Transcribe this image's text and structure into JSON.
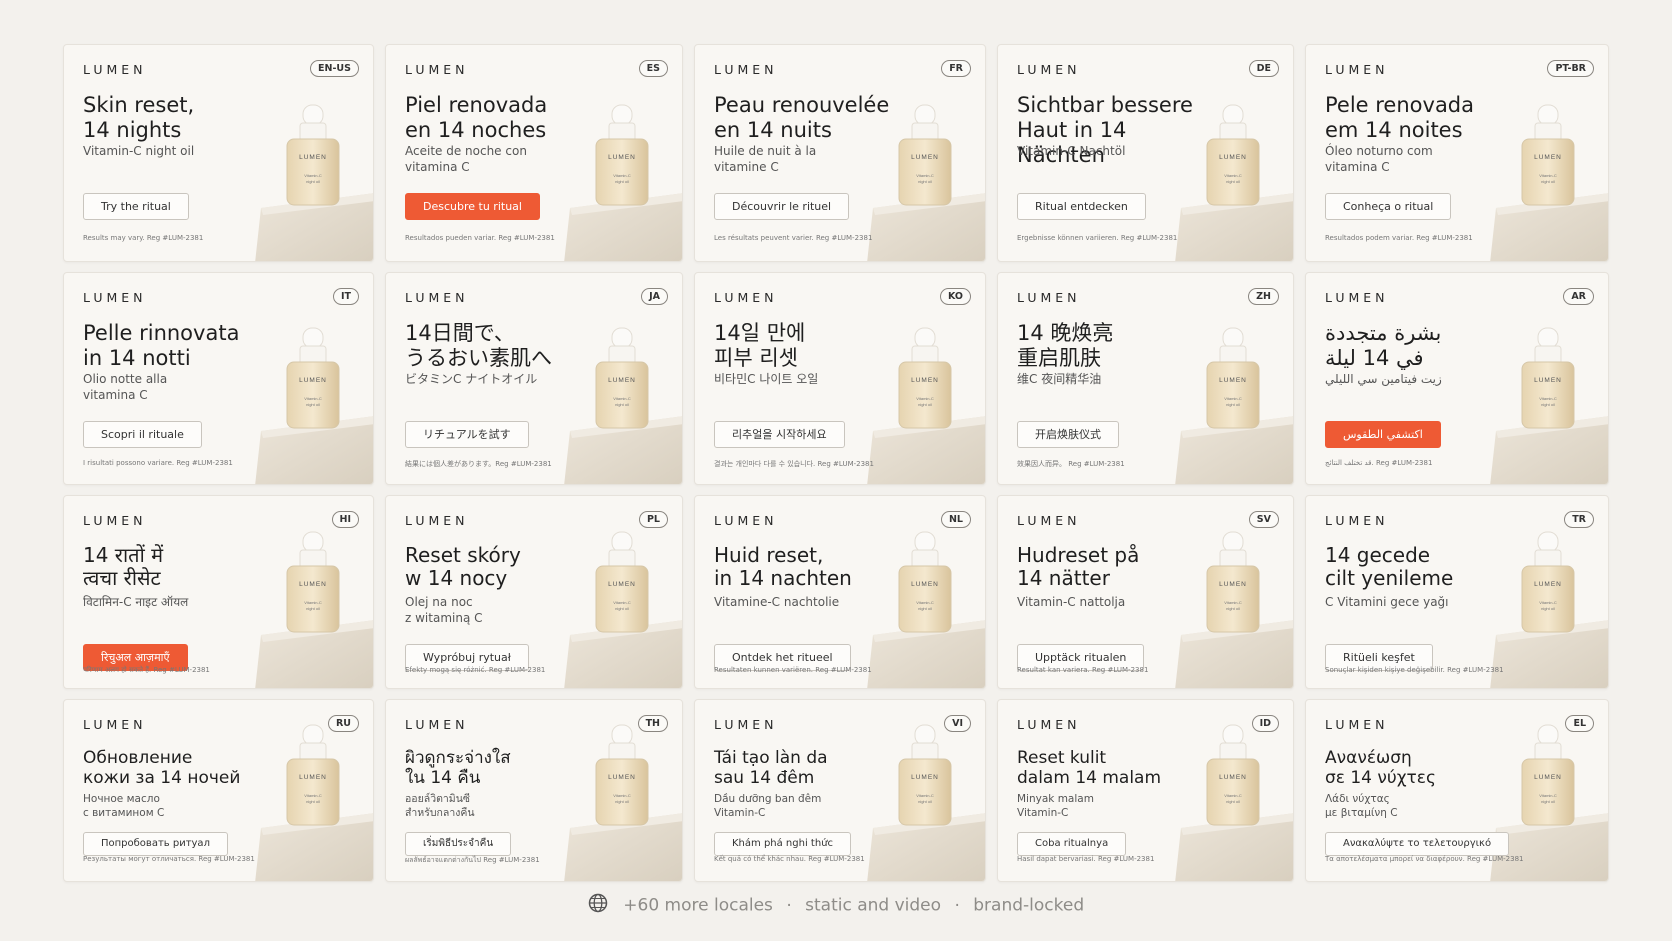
{
  "cards": [
    {
      "brand": "LUMEN",
      "badge": "EN-US",
      "headline": "Skin reset,\n14 nights",
      "subline": "Vitamin-C night oil",
      "cta": "Try the ritual",
      "accent": false,
      "disclaimer": "Results may vary. Reg #LUM-2381"
    },
    {
      "brand": "LUMEN",
      "badge": "ES",
      "headline": "Piel renovada\nen 14 noches",
      "subline": "Aceite de noche con\nvitamina C",
      "cta": "Descubre tu ritual",
      "accent": true,
      "disclaimer": "Resultados pueden variar. Reg #LUM-2381"
    },
    {
      "brand": "LUMEN",
      "badge": "FR",
      "headline": "Peau renouvelée\nen 14 nuits",
      "subline": "Huile de nuit à la\nvitamine C",
      "cta": "Découvrir le rituel",
      "accent": false,
      "disclaimer": "Les résultats peuvent varier. Reg #LUM-2381"
    },
    {
      "brand": "LUMEN",
      "badge": "DE",
      "headline": "Sichtbar bessere\nHaut in 14 Nächten",
      "subline": "Vitamin-C Nachtöl",
      "cta": "Ritual entdecken",
      "accent": false,
      "disclaimer": "Ergebnisse können variieren. Reg #LUM-2381"
    },
    {
      "brand": "LUMEN",
      "badge": "PT-BR",
      "headline": "Pele renovada\nem 14 noites",
      "subline": "Óleo noturno com\nvitamina C",
      "cta": "Conheça o ritual",
      "accent": false,
      "disclaimer": "Resultados podem variar. Reg #LUM-2381"
    },
    {
      "brand": "LUMEN",
      "badge": "IT",
      "headline": "Pelle rinnovata\nin 14 notti",
      "subline": "Olio notte alla\nvitamina C",
      "cta": "Scopri il rituale",
      "accent": false,
      "disclaimer": "I risultati possono variare. Reg #LUM-2381"
    },
    {
      "brand": "LUMEN",
      "badge": "JA",
      "headline": "14日間で、\nうるおい素肌へ",
      "subline": "ビタミンC ナイトオイル",
      "cta": "リチュアルを試す",
      "accent": false,
      "disclaimer": "結果には個人差があります。Reg #LUM-2381"
    },
    {
      "brand": "LUMEN",
      "badge": "KO",
      "headline": "14일 만에\n피부 리셋",
      "subline": "비타민C 나이트 오일",
      "cta": "리추얼을 시작하세요",
      "accent": false,
      "disclaimer": "결과는 개인마다 다를 수 있습니다. Reg #LUM-2381"
    },
    {
      "brand": "LUMEN",
      "badge": "ZH",
      "headline": "14 晚焕亮\n重启肌肤",
      "subline": "维C 夜间精华油",
      "cta": "开启焕肤仪式",
      "accent": false,
      "disclaimer": "效果因人而异。 Reg #LUM-2381"
    },
    {
      "brand": "LUMEN",
      "badge": "AR",
      "headline": "بشرة متجددة\nفي 14 ليلة",
      "subline": "زيت فيتامين سي الليلي",
      "cta": "اكتشفي الطقوس",
      "accent": true,
      "disclaimer": "قد تختلف النتائج. Reg #LUM-2381"
    },
    {
      "brand": "LUMEN",
      "badge": "HI",
      "headline": "14 रातों में\nत्वचा रीसेट",
      "subline": "विटामिन-C नाइट ऑयल",
      "cta": "रिचुअल आज़माएँ",
      "accent": true,
      "disclaimer": "परिणाम अलग हो सकते हैं. Reg #LUM-2381"
    },
    {
      "brand": "LUMEN",
      "badge": "PL",
      "headline": "Reset skóry\nw 14 nocy",
      "subline": "Olej na noc\nz witaminą C",
      "cta": "Wypróbuj rytuał",
      "accent": false,
      "disclaimer": "Efekty mogą się różnić. Reg #LUM-2381"
    },
    {
      "brand": "LUMEN",
      "badge": "NL",
      "headline": "Huid reset,\nin 14 nachten",
      "subline": "Vitamine-C nachtolie",
      "cta": "Ontdek het ritueel",
      "accent": false,
      "disclaimer": "Resultaten kunnen variëren. Reg #LUM-2381"
    },
    {
      "brand": "LUMEN",
      "badge": "SV",
      "headline": "Hudreset på\n14 nätter",
      "subline": "Vitamin-C nattolja",
      "cta": "Upptäck ritualen",
      "accent": false,
      "disclaimer": "Resultat kan variera. Reg #LUM-2381"
    },
    {
      "brand": "LUMEN",
      "badge": "TR",
      "headline": "14 gecede\ncilt yenileme",
      "subline": "C Vitamini gece yağı",
      "cta": "Ritüeli keşfet",
      "accent": false,
      "disclaimer": "Sonuçlar kişiden kişiye değişebilir. Reg #LUM-2381"
    },
    {
      "brand": "LUMEN",
      "badge": "RU",
      "headline": "Обновление\nкожи за 14 ночей",
      "subline": "Ночное масло\nс витамином С",
      "cta": "Попробовать ритуал",
      "accent": false,
      "disclaimer": "Результаты могут отличаться. Reg #LUM-2381"
    },
    {
      "brand": "LUMEN",
      "badge": "TH",
      "headline": "ผิวดูกระจ่างใส\nใน 14 คืน",
      "subline": "ออยล์วิตามินซี\nสำหรับกลางคืน",
      "cta": "เริ่มพิธีประจำคืน",
      "accent": false,
      "disclaimer": "ผลลัพธ์อาจแตกต่างกันไป Reg #LUM-2381"
    },
    {
      "brand": "LUMEN",
      "badge": "VI",
      "headline": "Tái tạo làn da\nsau 14 đêm",
      "subline": "Dầu dưỡng ban đêm\nVitamin-C",
      "cta": "Khám phá nghi thức",
      "accent": false,
      "disclaimer": "Kết quả có thể khác nhau. Reg #LUM-2381"
    },
    {
      "brand": "LUMEN",
      "badge": "ID",
      "headline": "Reset kulit\ndalam 14 malam",
      "subline": "Minyak malam\nVitamin-C",
      "cta": "Coba ritualnya",
      "accent": false,
      "disclaimer": "Hasil dapat bervariasi. Reg #LUM-2381"
    },
    {
      "brand": "LUMEN",
      "badge": "EL",
      "headline": "Ανανέωση\nσε 14 νύχτες",
      "subline": "Λάδι νύχτας\nμε βιταμίνη C",
      "cta": "Ανακαλύψτε το τελετουργικό",
      "accent": false,
      "disclaimer": "Τα αποτελέσματα μπορεί να διαφέρουν. Reg #LUM-2381"
    }
  ],
  "product_label": "LUMEN",
  "product_sublabel": "Vitamin-C\nnight oil",
  "footer": {
    "icon": "globe-icon",
    "more_locales": "+60 more locales",
    "formats": "static and video",
    "brand": "brand-locked",
    "separator": "·"
  },
  "colors": {
    "accent": "#ee5a34",
    "background": "#f3f1ed",
    "card": "#f9f7f3"
  }
}
